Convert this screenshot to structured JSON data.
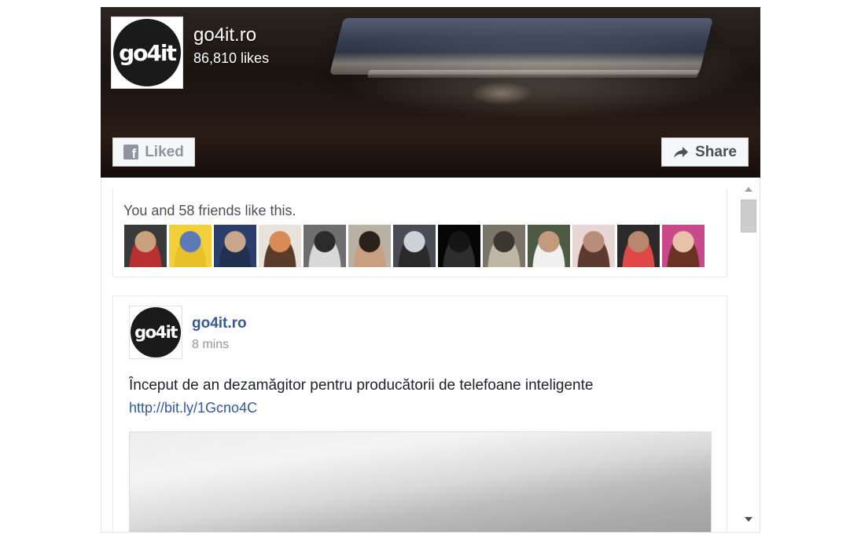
{
  "page": {
    "name": "go4it.ro",
    "likes": "86,810 likes",
    "logo_text": "go4it"
  },
  "buttons": {
    "liked_label": "Liked",
    "share_label": "Share",
    "liked_icon": "facebook-f-icon",
    "share_icon": "share-arrow-icon"
  },
  "friends": {
    "text": "You and 58 friends like this.",
    "avatars": [
      {
        "name": "friend-avatar-1",
        "colors": [
          "#3a3a3a",
          "#caa17f",
          "#b83030"
        ]
      },
      {
        "name": "friend-avatar-2",
        "colors": [
          "#f2d03a",
          "#5c7ab8",
          "#e8c12a"
        ]
      },
      {
        "name": "friend-avatar-3",
        "colors": [
          "#2b3f6c",
          "#c9a68c",
          "#22304f"
        ]
      },
      {
        "name": "friend-avatar-4",
        "colors": [
          "#e8e4dc",
          "#d98b55",
          "#5a3c2a"
        ]
      },
      {
        "name": "friend-avatar-5",
        "colors": [
          "#6e6e6e",
          "#2b2b2b",
          "#d8d8d8"
        ]
      },
      {
        "name": "friend-avatar-6",
        "colors": [
          "#b9b1a4",
          "#2b211c",
          "#c9a07f"
        ]
      },
      {
        "name": "friend-avatar-7",
        "colors": [
          "#494c55",
          "#d0d0d8",
          "#2a2a2a"
        ]
      },
      {
        "name": "friend-avatar-8",
        "colors": [
          "#060606",
          "#151515",
          "#2d2d2d"
        ]
      },
      {
        "name": "friend-avatar-9",
        "colors": [
          "#7b7569",
          "#3a3630",
          "#bfb6a6"
        ]
      },
      {
        "name": "friend-avatar-10",
        "colors": [
          "#4c5a46",
          "#c49a7c",
          "#f0f0f0"
        ]
      },
      {
        "name": "friend-avatar-11",
        "colors": [
          "#e7d6d3",
          "#b98c7c",
          "#5c3a30"
        ]
      },
      {
        "name": "friend-avatar-12",
        "colors": [
          "#2a2a2a",
          "#b8876e",
          "#e04848"
        ]
      },
      {
        "name": "friend-avatar-13",
        "colors": [
          "#c94a8a",
          "#e7c2a9",
          "#6b3323"
        ]
      }
    ]
  },
  "post": {
    "author": "go4it.ro",
    "time": "8 mins",
    "text": "Început de an dezamăgitor pentru producătorii de telefoane inteligente",
    "link": "http://bit.ly/1Gcno4C",
    "logo_text": "go4it"
  },
  "colors": {
    "link_blue": "#365899",
    "muted_gray": "#90949c",
    "cover_dark": "#1a1411"
  }
}
